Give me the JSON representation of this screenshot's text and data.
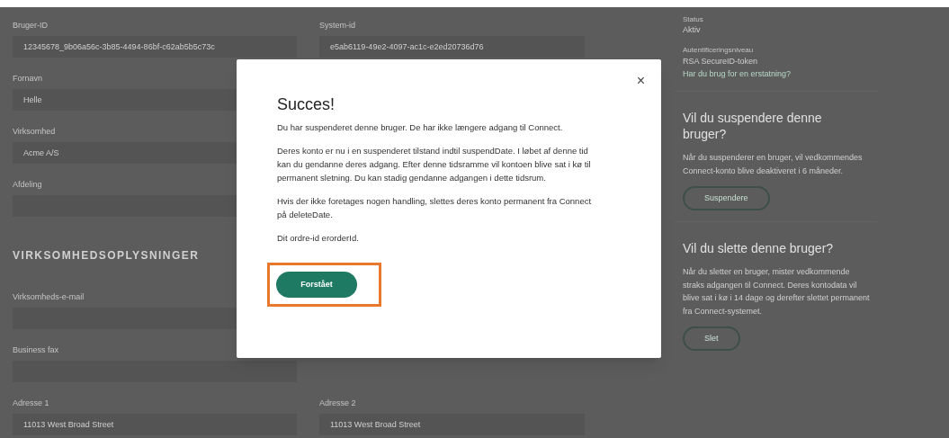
{
  "left_fields": [
    {
      "label": "Bruger-ID",
      "value": "12345678_9b06a56c-3b85-4494-86bf-c62ab5b5c73c"
    },
    {
      "label": "Fornavn",
      "value": "Helle"
    },
    {
      "label": "Virksomhed",
      "value": "Acme A/S"
    },
    {
      "label": "Afdeling"
    }
  ],
  "section_heading": "VIRKSOMHEDSOPLYSNINGER",
  "company_fields": [
    {
      "label": "Virksomheds-e-mail"
    },
    {
      "label": "Business fax"
    }
  ],
  "middle_fields": [
    {
      "label": "System-id",
      "value": "e5ab6119-49e2-4097-ac1c-e2ed20736d76"
    }
  ],
  "address_fields": [
    {
      "label": "Adresse 1",
      "value": "11013 West Broad Street"
    },
    {
      "label": "Adresse 2",
      "value": "11013 West Broad Street"
    }
  ],
  "sidebar": {
    "status_label": "Status",
    "status_value": "Aktiv",
    "auth_label": "Autentificeringsniveau",
    "auth_value": "RSA SecureID-token",
    "replace_link": "Har du brug for en erstatning?",
    "sections": [
      {
        "heading": "Vil du suspendere denne bruger?",
        "text": "Når du suspenderer en bruger, vil vedkommendes Connect-konto blive deaktiveret i 6 måneder.",
        "button": "Suspendere"
      },
      {
        "heading": "Vil du slette denne bruger?",
        "text": "Når du sletter en bruger, mister vedkommende straks adgangen til Connect. Deres kontodata vil blive sat i kø i 14 dage og derefter slettet permanent fra Connect-systemet.",
        "button": "Slet"
      }
    ]
  },
  "modal": {
    "close": "×",
    "title": "Succes!",
    "paragraphs": [
      "Du har suspenderet denne bruger. De har ikke længere adgang til Connect.",
      "Deres konto er nu i en suspenderet tilstand indtil suspendDate. I løbet af denne tid kan du gendanne deres adgang. Efter denne tidsramme vil kontoen blive sat i kø til permanent sletning. Du kan stadig gendanne adgangen i dette tidsrum.",
      "Hvis der ikke foretages nogen handling, slettes deres konto permanent fra Connect på deleteDate.",
      "Dit ordre-id erorderId."
    ],
    "button": {
      "label": "Forstået",
      "highlighted": true
    }
  }
}
